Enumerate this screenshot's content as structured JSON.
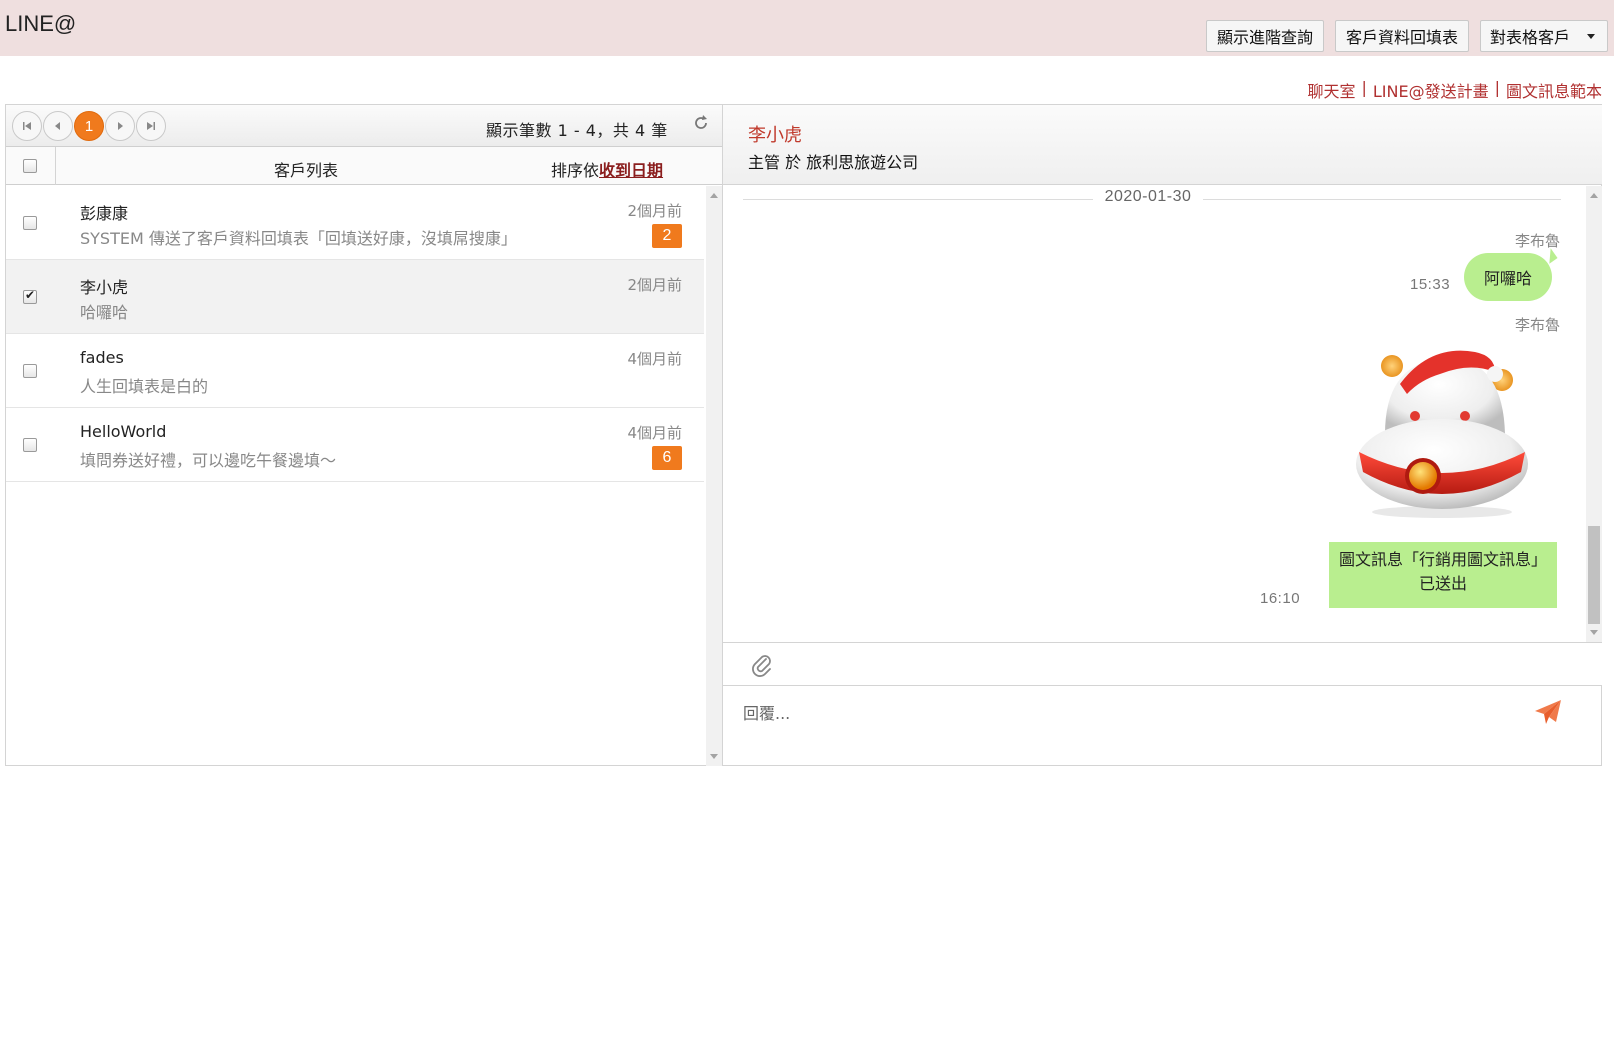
{
  "header": {
    "brand": "LINE@",
    "buttons": {
      "advanced_search": "顯示進階查詢",
      "customer_form": "客戶資料回填表",
      "table_customer": "對表格客戶"
    }
  },
  "top_links": [
    "聊天室",
    "LINE@發送計畫",
    "圖文訊息範本"
  ],
  "pager": {
    "current_page": "1",
    "info": "顯示筆數 1 - 4，共 4 筆"
  },
  "list_header": {
    "title": "客戶列表",
    "sort_prefix": "排序依",
    "sort_key": "收到日期"
  },
  "customers": [
    {
      "name": "彭康康",
      "preview": "SYSTEM 傳送了客戶資料回填表「回填送好康，沒填屌搜康」",
      "time": "2個月前",
      "badge": "2"
    },
    {
      "name": "李小虎",
      "preview": "哈囉哈",
      "time": "2個月前",
      "badge": ""
    },
    {
      "name": "fades",
      "preview": "人生回填表是白的",
      "time": "4個月前",
      "badge": ""
    },
    {
      "name": "HelloWorld",
      "preview": "填問券送好禮，可以邊吃午餐邊填～",
      "time": "4個月前",
      "badge": "6"
    }
  ],
  "chat": {
    "contact_name": "李小虎",
    "contact_sub": "主管 於 旅利思旅遊公司",
    "date": "2020-01-30",
    "messages": [
      {
        "sender": "李布魯",
        "text": "阿囉哈",
        "time": "15:33"
      },
      {
        "sender": "李布魯",
        "sticker": "hamster-sticker"
      },
      {
        "text_line1": "圖文訊息「行銷用圖文訊息」",
        "text_line2": "已送出",
        "time": "16:10"
      }
    ],
    "reply_placeholder": "回覆..."
  },
  "colors": {
    "header_bg": "#efdfdf",
    "accent": "#f07a1d",
    "link": "#b03030",
    "bubble": "#b9ee8f"
  }
}
